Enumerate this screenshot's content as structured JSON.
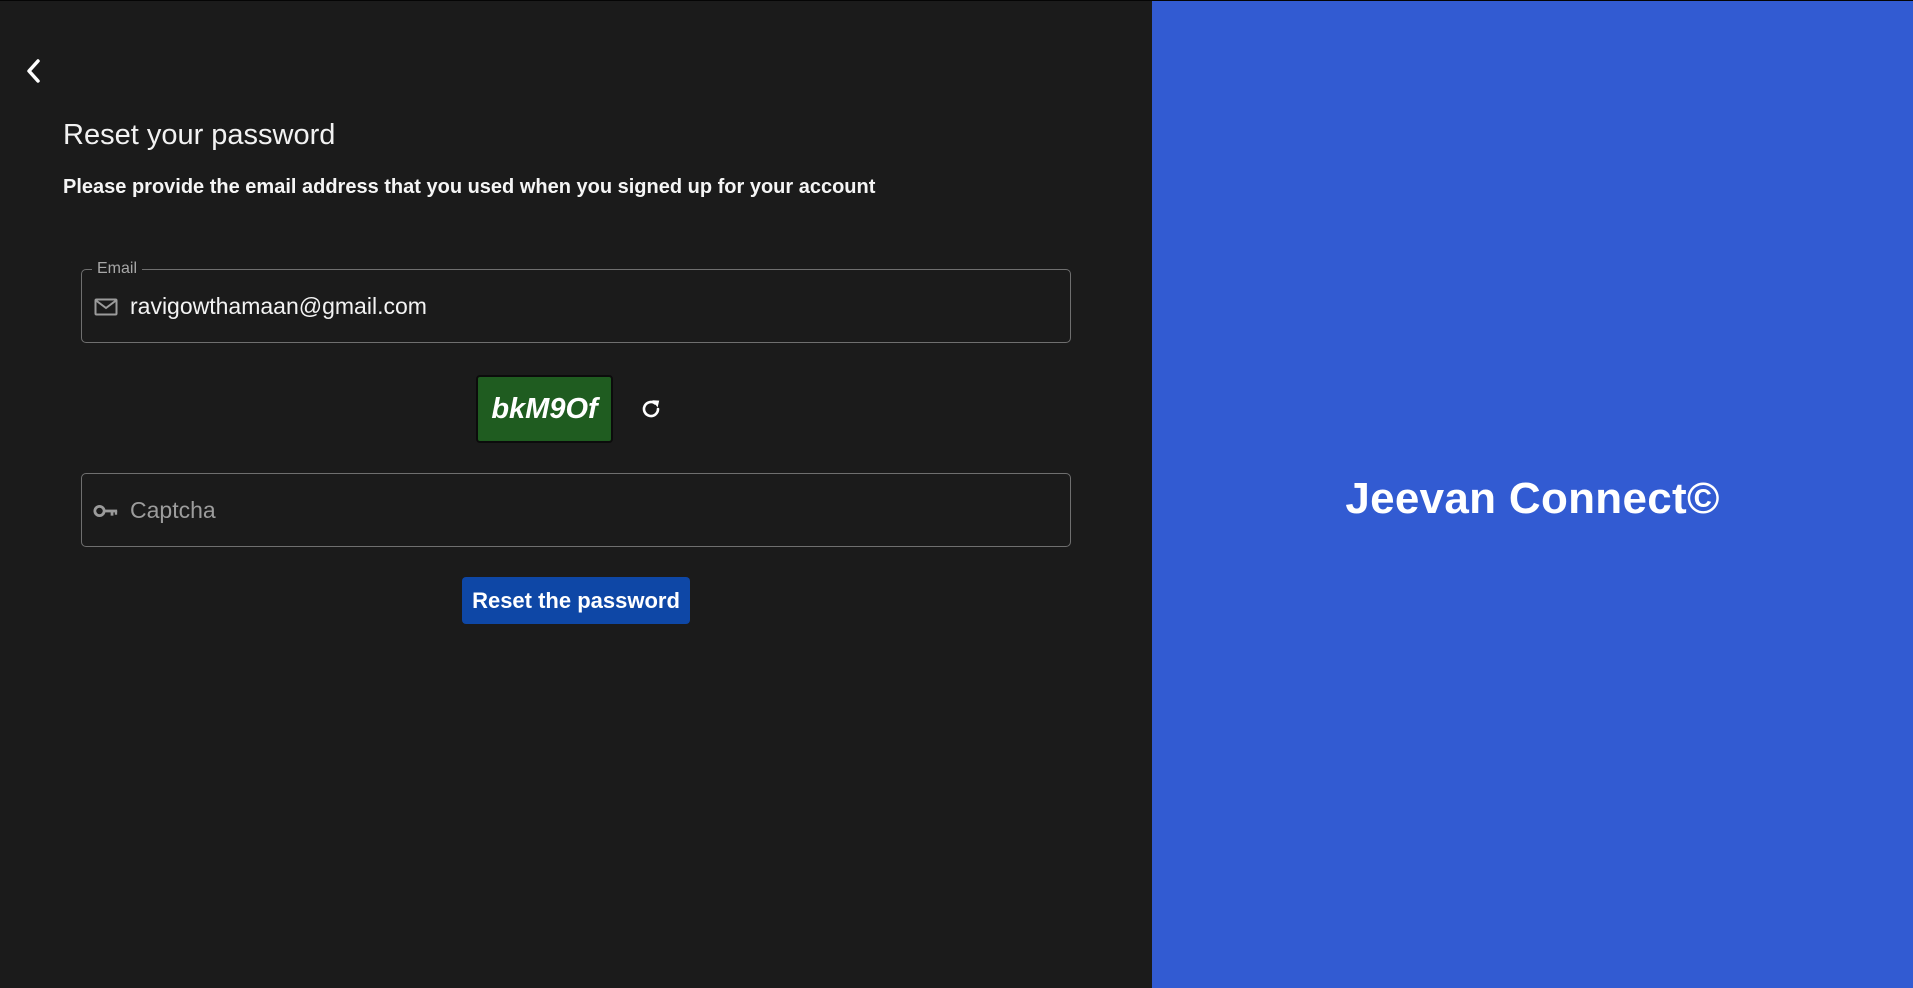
{
  "header": {
    "back_icon": "chevron-left-icon",
    "title": "Reset your password",
    "subtitle": "Please provide the email address that you used when you signed up for your account"
  },
  "email_field": {
    "legend": "Email",
    "icon": "mail-icon",
    "value": "ravigowthamaan@gmail.com"
  },
  "captcha": {
    "code": "bkM9Of",
    "refresh_icon": "refresh-icon",
    "input_icon": "key-icon",
    "placeholder": "Captcha",
    "value": ""
  },
  "submit": {
    "label": "Reset the password"
  },
  "brand": {
    "name": "Jeevan Connect©"
  },
  "colors": {
    "left_background": "#1b1b1b",
    "right_background": "#325bd2",
    "button": "#0e47a6",
    "captcha_background": "#1f5c20"
  }
}
